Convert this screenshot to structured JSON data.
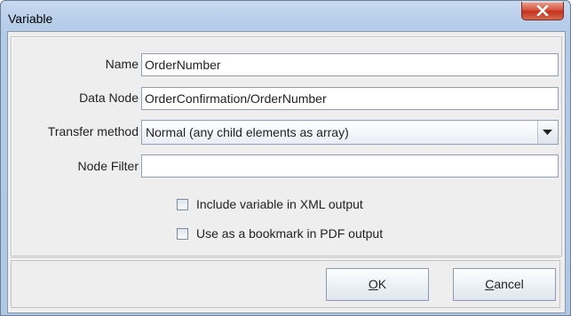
{
  "window": {
    "title": "Variable",
    "close_icon": "close-x-icon"
  },
  "form": {
    "name": {
      "label": "Name",
      "value": "OrderNumber"
    },
    "data_node": {
      "label": "Data Node",
      "value": "OrderConfirmation/OrderNumber"
    },
    "transfer_method": {
      "label": "Transfer method",
      "selected": "Normal (any child elements as array)",
      "arrow_icon": "chevron-down-icon"
    },
    "node_filter": {
      "label": "Node Filter",
      "value": ""
    },
    "include_xml": {
      "label": "Include variable in XML output",
      "checked": false
    },
    "bookmark_pdf": {
      "label": "Use as a bookmark in PDF output",
      "checked": false
    }
  },
  "buttons": {
    "ok": {
      "mnemonic": "O",
      "rest": "K"
    },
    "cancel": {
      "mnemonic": "C",
      "rest": "ancel"
    }
  },
  "colors": {
    "title_bar": "#b9cfea",
    "dialog_bg": "#eeeeee",
    "close_button": "#c4321a"
  }
}
